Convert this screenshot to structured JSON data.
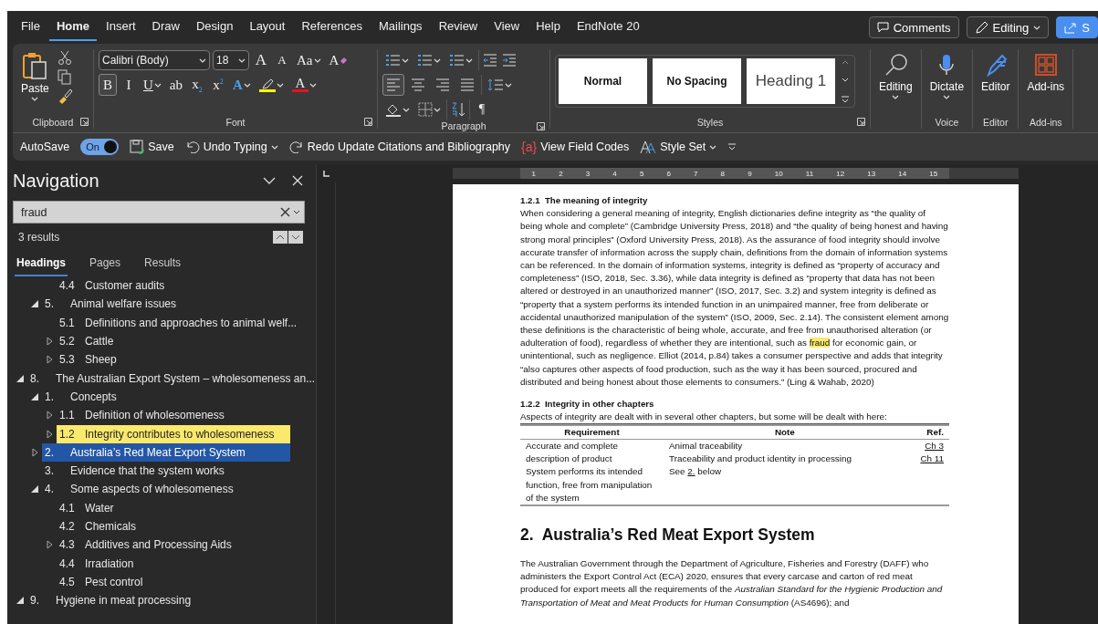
{
  "menu": {
    "tabs": [
      {
        "label": "File",
        "selected": false
      },
      {
        "label": "Home",
        "selected": true
      },
      {
        "label": "Insert",
        "selected": false
      },
      {
        "label": "Draw",
        "selected": false
      },
      {
        "label": "Design",
        "selected": false
      },
      {
        "label": "Layout",
        "selected": false
      },
      {
        "label": "References",
        "selected": false
      },
      {
        "label": "Mailings",
        "selected": false
      },
      {
        "label": "Review",
        "selected": false
      },
      {
        "label": "View",
        "selected": false
      },
      {
        "label": "Help",
        "selected": false
      },
      {
        "label": "EndNote 20",
        "selected": false
      }
    ],
    "comments": "Comments",
    "editing": "Editing",
    "share": "S"
  },
  "ribbon": {
    "clipboard": {
      "paste": "Paste",
      "label": "Clipboard"
    },
    "font": {
      "name": "Calibri (Body)",
      "size": "18",
      "label": "Font",
      "row1": [
        {
          "kind": "grow",
          "glyph": "A"
        },
        {
          "kind": "shrink",
          "glyph": "A"
        },
        {
          "kind": "case",
          "glyph": "Aa"
        },
        {
          "kind": "clear",
          "glyph": "A"
        }
      ],
      "row2": [
        {
          "kind": "toggle",
          "glyph": "B",
          "on": true
        },
        {
          "kind": "toggle",
          "glyph": "I",
          "on": false
        },
        {
          "kind": "underline",
          "glyph": "U",
          "on": false
        },
        {
          "kind": "toggle",
          "glyph": "ab",
          "on": false
        },
        {
          "kind": "toggle",
          "glyph": "x$_{2}$",
          "on": false
        },
        {
          "kind": "toggle",
          "glyph": "x$^{2}$",
          "on": false
        },
        {
          "kind": "effects",
          "glyph": "A"
        },
        {
          "kind": "highlight",
          "color": "#ffff00"
        },
        {
          "kind": "fontcolor",
          "glyph": "A",
          "color": "#e81123"
        }
      ]
    },
    "paragraph": {
      "label": "Paragraph",
      "pilcrow": "¶",
      "align": [
        {
          "kind": "left",
          "selected": true
        },
        {
          "kind": "center",
          "selected": false
        },
        {
          "kind": "right",
          "selected": false
        },
        {
          "kind": "justify",
          "selected": false
        }
      ]
    },
    "styles": {
      "label": "Styles",
      "items": [
        {
          "kind": "normal",
          "label": "Normal"
        },
        {
          "kind": "nospacing",
          "label": "No Spacing"
        },
        {
          "kind": "heading",
          "label": "Heading 1"
        }
      ]
    },
    "side_groups": [
      {
        "buttons": [
          {
            "kind": "find",
            "label": "Editing",
            "caret": true
          }
        ]
      },
      {
        "label": "Voice",
        "buttons": [
          {
            "kind": "mic",
            "label": "Dictate",
            "caret": true
          }
        ]
      },
      {
        "label": "Editor",
        "buttons": [
          {
            "kind": "pen",
            "label": "Editor",
            "caret": false
          }
        ]
      },
      {
        "label": "Add-ins",
        "buttons": [
          {
            "kind": "addins",
            "label": "Add-ins",
            "caret": false
          }
        ]
      }
    ]
  },
  "quick": {
    "autosave": {
      "label": "AutoSave",
      "state": "On",
      "on": true
    },
    "items": [
      {
        "kind": "save",
        "label": "Save"
      },
      {
        "kind": "undo",
        "label": "Undo Typing",
        "caret": true
      },
      {
        "kind": "redo",
        "label": "Redo Update Citations and Bibliography",
        "caret": false
      },
      {
        "kind": "fieldcodes",
        "glyph": "{a}",
        "label": "View Field Codes",
        "caret": false
      },
      {
        "kind": "styleset",
        "label": "Style Set",
        "caret": true
      },
      {
        "kind": "customize"
      }
    ]
  },
  "navigation": {
    "title": "Navigation",
    "search": {
      "value": "fraud"
    },
    "results": "3 results",
    "tabs": [
      {
        "label": "Headings",
        "selected": true
      },
      {
        "label": "Pages",
        "selected": false
      },
      {
        "label": "Results",
        "selected": false
      }
    ],
    "tree": [
      {
        "children": [
          {
            "children": [
              {
                "number": "4.4",
                "title": "Customer audits",
                "selected": false,
                "hit": false
              }
            ]
          },
          {
            "number": "5.",
            "title": "Animal welfare issues",
            "expanded": true,
            "selected": false,
            "hit": false,
            "children": [
              {
                "number": "5.1",
                "title": "Definitions and approaches to animal welf...",
                "selected": false,
                "hit": false
              },
              {
                "number": "5.2",
                "title": "Cattle",
                "expanded": false,
                "selected": false,
                "hit": false
              },
              {
                "number": "5.3",
                "title": "Sheep",
                "expanded": false,
                "selected": false,
                "hit": false
              }
            ]
          }
        ]
      },
      {
        "number": "8.",
        "title": "The Australian Export System – wholesomeness an...",
        "expanded": true,
        "selected": false,
        "hit": false,
        "children": [
          {
            "number": "1.",
            "title": "Concepts",
            "expanded": true,
            "selected": false,
            "hit": false,
            "children": [
              {
                "number": "1.1",
                "title": "Definition of wholesomeness",
                "expanded": false,
                "selected": false,
                "hit": false
              },
              {
                "number": "1.2",
                "title": "Integrity contributes to wholesomeness",
                "expanded": false,
                "selected": false,
                "hit": true
              }
            ]
          },
          {
            "number": "2.",
            "title": "Australia’s Red Meat Export System",
            "expanded": false,
            "selected": true,
            "hit": false
          },
          {
            "number": "3.",
            "title": "Evidence that the system works",
            "selected": false,
            "hit": false
          },
          {
            "number": "4.",
            "title": "Some aspects of wholesomeness",
            "expanded": true,
            "selected": false,
            "hit": false,
            "children": [
              {
                "number": "4.1",
                "title": "Water",
                "selected": false,
                "hit": false
              },
              {
                "number": "4.2",
                "title": "Chemicals",
                "selected": false,
                "hit": false
              },
              {
                "number": "4.3",
                "title": "Additives and Processing Aids",
                "expanded": false,
                "selected": false,
                "hit": false
              },
              {
                "number": "4.4",
                "title": "Irradiation",
                "selected": false,
                "hit": false
              },
              {
                "number": "4.5",
                "title": "Pest control",
                "selected": false,
                "hit": false
              }
            ]
          }
        ]
      },
      {
        "number": "9.",
        "title": "Hygiene in meat processing",
        "expanded": true,
        "selected": false,
        "hit": false
      }
    ]
  },
  "document": {
    "ruler_marks": [
      "1",
      "2",
      "3",
      "4",
      "5",
      "6",
      "7",
      "8",
      "9",
      "10",
      "11",
      "12",
      "13",
      "14",
      "15"
    ],
    "heading_1": "1.2.1  The meaning of integrity",
    "paragraph_1": [
      {
        "text": "When considering a general meaning of integrity, English dictionaries define integrity as “the quality of being whole and complete” (Cambridge University Press, 2018) and “the quality of being honest and having strong moral principles” (Oxford University Press, 2018). As the assurance of food integrity should involve accurate transfer of information across the supply chain, definitions from the domain of information systems can be referenced. In the domain of information systems, integrity is defined as “property of accuracy and completeness” (ISO, 2018, Sec. 3.36), while data integrity is defined as “property that data has not been altered or destroyed in an unauthorized manner” (ISO, 2017, Sec. 3.2) and system integrity is defined as “property that a system performs its intended function in an unimpaired manner, free from deliberate or accidental unauthorized manipulation of the system” (ISO, 2009, Sec. 2.14). The consistent element among these definitions is the characteristic of being whole, accurate, and free from unauthorised alteration (or adulteration of food), regardless of whether they are intentional, such as ",
        "hit": false
      },
      {
        "text": "fraud",
        "hit": true
      },
      {
        "text": " for economic gain, or unintentional, such as negligence. Elliot (2014, p.84) takes a consumer perspective and adds that integrity “also captures other aspects of food production, such as the way it has been sourced, procured and distributed and being honest about those elements to consumers.”  (Ling & Wahab, 2020)",
        "hit": false
      }
    ],
    "heading_2": "1.2.2  Integrity in other chapters",
    "table_intro": "Aspects of integrity are dealt with in several other chapters, but some will be dealt with here:",
    "table": {
      "columns": [
        "Requirement",
        "Note",
        "Ref."
      ],
      "rows": [
        {
          "requirement": "Accurate and complete description of product",
          "notes": [
            [
              {
                "text": "Animal traceability",
                "link": false
              }
            ],
            [
              {
                "text": "Traceability and product identity in processing",
                "link": false
              }
            ]
          ],
          "refs": [
            "Ch 3",
            "Ch 11"
          ]
        },
        {
          "requirement": "System performs its intended function, free from manipulation of the system",
          "notes": [
            [
              {
                "text": "See ",
                "link": false
              },
              {
                "text": "2.",
                "link": true
              },
              {
                "text": " below",
                "link": false
              }
            ]
          ],
          "refs": []
        }
      ]
    },
    "chapter_heading": "2.  Australia’s Red Meat Export System",
    "paragraph_2": "The Australian Government through the Department of Agriculture, Fisheries and Forestry (DAFF) who administers the Export Control Act (ECA) 2020, ensures that every carcase and carton of red meat produced for export meets all the requirements of the *Australian Standard for the Hygienic Production and Transportation of Meat and Meat Products for Human Consumption* (AS4696); and"
  }
}
